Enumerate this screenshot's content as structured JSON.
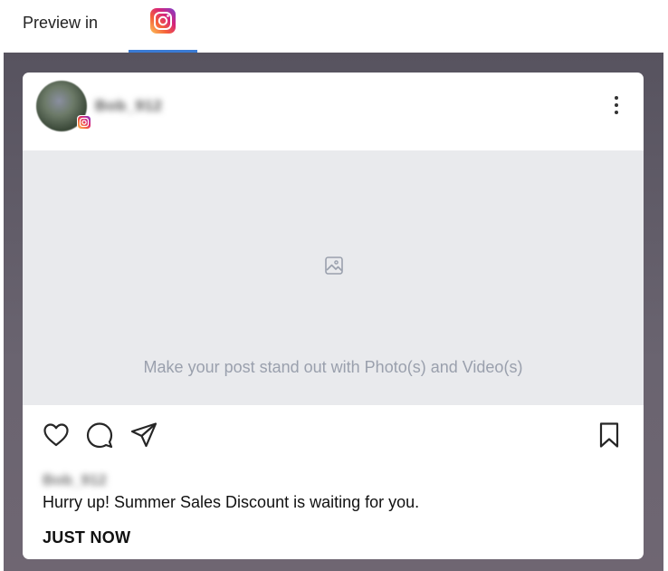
{
  "header": {
    "preview_label": "Preview in",
    "active_tab": "instagram-icon"
  },
  "post": {
    "username": "Bob_912",
    "media_placeholder": "Make your post stand out with Photo(s) and Video(s)",
    "caption_username": "Bob_912",
    "caption": "Hurry up! Summer Sales Discount is waiting for you.",
    "timestamp": "JUST NOW"
  },
  "icons": {
    "like": "heart-icon",
    "comment": "comment-bubble-icon",
    "share": "paper-plane-icon",
    "save": "bookmark-icon",
    "more": "vertical-dots-icon",
    "media": "image-icon"
  },
  "colors": {
    "tab_underline": "#3a7bd5",
    "stage_bg": "#5f5a66",
    "media_bg": "#e9eaed"
  }
}
